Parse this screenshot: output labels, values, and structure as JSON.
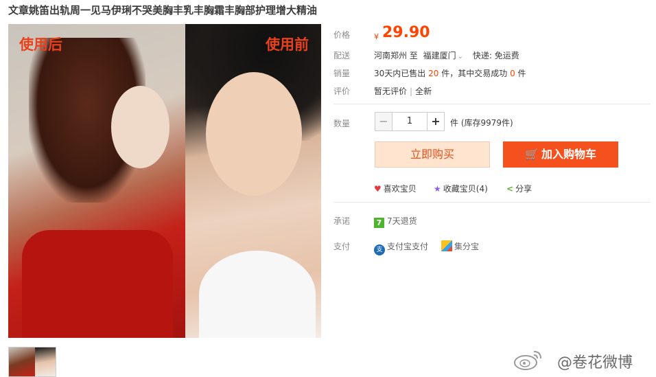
{
  "product": {
    "title": "文章姚笛出轨周一见马伊琍不哭美胸丰乳丰胸霜丰胸部护理增大精油",
    "image_tags": {
      "after": "使用后",
      "before": "使用前"
    }
  },
  "labels": {
    "price": "价格",
    "delivery": "配送",
    "sales": "销量",
    "rating": "评价",
    "quantity": "数量",
    "promise": "承诺",
    "payment": "支付"
  },
  "price": {
    "currency": "¥",
    "amount": "29.90"
  },
  "delivery": {
    "from": "河南郑州 至",
    "to": "福建厦门",
    "dropdown": "⌄",
    "shipping": "快递: 免运费"
  },
  "sales": {
    "prefix": "30天内已售出",
    "sold": "20",
    "mid": "件，其中交易成功",
    "success": "0",
    "suffix": "件"
  },
  "rating": {
    "text": "暂无评价",
    "sep": "|",
    "condition": "全新"
  },
  "quantity": {
    "minus": "−",
    "value": "1",
    "plus": "+",
    "unit": "件 (库存9979件)"
  },
  "buttons": {
    "buy_now": "立即购买",
    "add_cart": "加入购物车",
    "cart_icon": "🛒"
  },
  "social": {
    "like": {
      "icon": "heart-icon",
      "label": "喜欢宝贝"
    },
    "favorite": {
      "icon": "star-icon",
      "label": "收藏宝贝(4)"
    },
    "share": {
      "icon": "share-icon",
      "label": "分享"
    }
  },
  "promise": {
    "badge": "7",
    "text": "7天退货"
  },
  "payment": {
    "alipay_icon": "支",
    "alipay": "支付宝支付",
    "jifenbao": "集分宝"
  },
  "watermark": {
    "text": "@卷花微博"
  },
  "colors": {
    "accent": "#ff4400",
    "buy_now_bg": "#ffe4d0",
    "add_cart_bg": "#f4511e"
  }
}
